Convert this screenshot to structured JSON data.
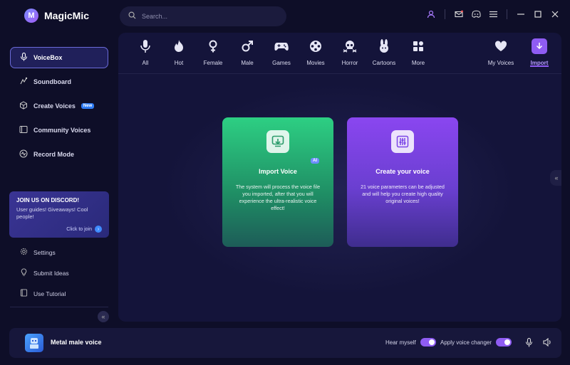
{
  "app": {
    "name": "MagicMic",
    "logo_letter": "M"
  },
  "search": {
    "placeholder": "Search..."
  },
  "colors": {
    "accent": "#8f5cf3",
    "import_card": "#2dcf83",
    "create_card": "#8a46f0",
    "background": "#0e0e28"
  },
  "sidebar": {
    "items": [
      {
        "label": "VoiceBox",
        "icon": "microphone-icon",
        "active": true
      },
      {
        "label": "Soundboard",
        "icon": "soundboard-icon"
      },
      {
        "label": "Create Voices",
        "icon": "cube-icon",
        "badge": "New"
      },
      {
        "label": "Community Voices",
        "icon": "community-icon"
      },
      {
        "label": "Record Mode",
        "icon": "waveform-icon"
      }
    ],
    "discord": {
      "title": "JOIN US ON DISCORD!",
      "subtitle": "User guides! Giveaways! Cool people!",
      "cta": "Click to join"
    },
    "bottom_items": [
      {
        "label": "Settings",
        "icon": "gear-icon"
      },
      {
        "label": "Submit Ideas",
        "icon": "lightbulb-icon"
      },
      {
        "label": "Use Tutorial",
        "icon": "book-icon"
      }
    ]
  },
  "categories": [
    {
      "label": "All",
      "icon": "microphone-icon"
    },
    {
      "label": "Hot",
      "icon": "flame-icon"
    },
    {
      "label": "Female",
      "icon": "female-icon"
    },
    {
      "label": "Male",
      "icon": "male-icon"
    },
    {
      "label": "Games",
      "icon": "gamepad-icon"
    },
    {
      "label": "Movies",
      "icon": "film-reel-icon"
    },
    {
      "label": "Horror",
      "icon": "skull-icon"
    },
    {
      "label": "Cartoons",
      "icon": "bunny-icon"
    },
    {
      "label": "More",
      "icon": "grid-icon"
    }
  ],
  "right_tabs": [
    {
      "label": "My Voices",
      "icon": "heart-icon"
    },
    {
      "label": "Import",
      "icon": "download-icon",
      "active": true
    }
  ],
  "cards": {
    "import": {
      "title": "Import Voice",
      "badge": "AI",
      "description": "The system will process the voice file you imported, after that you will experience the ultra-realistic voice effect!"
    },
    "create": {
      "title": "Create your voice",
      "description": "21 voice parameters can be adjusted and will help you create high quality original voices!"
    }
  },
  "bottom_bar": {
    "voice_name": "Metal male voice",
    "hear_myself_label": "Hear myself",
    "hear_myself_on": true,
    "apply_changer_label": "Apply voice changer",
    "apply_changer_on": true
  }
}
